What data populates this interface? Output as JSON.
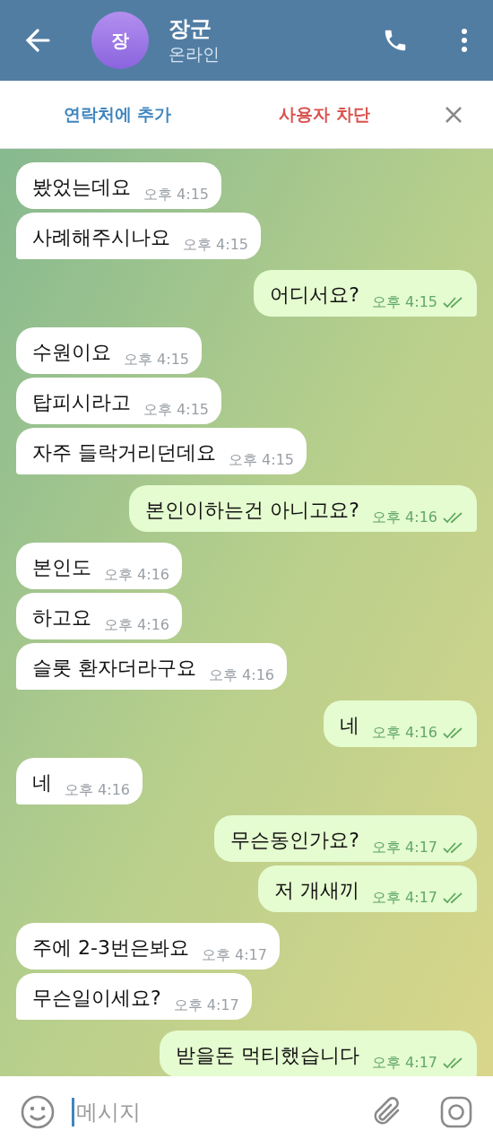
{
  "header": {
    "avatar_letter": "장",
    "name": "장군",
    "status": "온라인"
  },
  "action_bar": {
    "add_contact": "연락처에 추가",
    "block_user": "사용자 차단"
  },
  "messages": [
    {
      "kind": "incoming",
      "text": "봤었는데요",
      "time": "오후 4:15"
    },
    {
      "kind": "incoming",
      "text": "사례해주시나요",
      "time": "오후 4:15"
    },
    {
      "kind": "outgoing",
      "text": "어디서요?",
      "time": "오후 4:15",
      "read": true
    },
    {
      "kind": "incoming",
      "text": "수원이요",
      "time": "오후 4:15"
    },
    {
      "kind": "incoming",
      "text": "탑피시라고",
      "time": "오후 4:15"
    },
    {
      "kind": "incoming",
      "text": "자주 들락거리던데요",
      "time": "오후 4:15"
    },
    {
      "kind": "outgoing",
      "text": "본인이하는건 아니고요?",
      "time": "오후 4:16",
      "read": true
    },
    {
      "kind": "incoming",
      "text": "본인도",
      "time": "오후 4:16"
    },
    {
      "kind": "incoming",
      "text": "하고요",
      "time": "오후 4:16"
    },
    {
      "kind": "incoming",
      "text": "슬롯 환자더라구요",
      "time": "오후 4:16"
    },
    {
      "kind": "outgoing",
      "text": "네",
      "time": "오후 4:16",
      "read": true
    },
    {
      "kind": "incoming",
      "text": "네",
      "time": "오후 4:16"
    },
    {
      "kind": "outgoing",
      "text": "무슨동인가요?",
      "time": "오후 4:17",
      "read": true
    },
    {
      "kind": "outgoing",
      "text": "저 개새끼",
      "time": "오후 4:17",
      "read": true
    },
    {
      "kind": "incoming",
      "text": "주에 2-3번은봐요",
      "time": "오후 4:17"
    },
    {
      "kind": "incoming",
      "text": "무슨일이세요?",
      "time": "오후 4:17"
    },
    {
      "kind": "outgoing",
      "text": "받을돈 먹티했습니다",
      "time": "오후 4:17",
      "read": true
    }
  ],
  "composer": {
    "placeholder": "메시지"
  }
}
